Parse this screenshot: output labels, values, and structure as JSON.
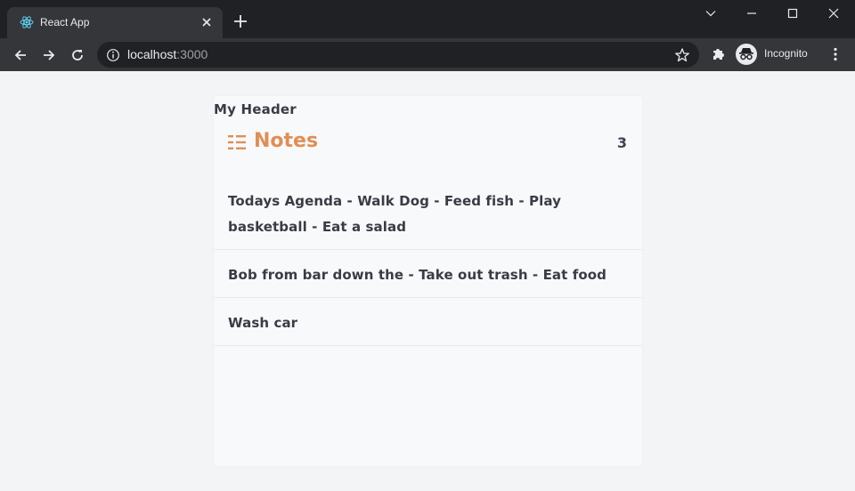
{
  "browser": {
    "tab_title": "React App",
    "url_host": "localhost",
    "url_port": ":3000",
    "incognito_label": "Incognito"
  },
  "page": {
    "header": "My Header",
    "notes_title": "Notes",
    "notes_count": "3",
    "notes": [
      {
        "text": "Todays Agenda - Walk Dog - Feed fish - Play basketball - Eat a salad"
      },
      {
        "text": "Bob from bar down the - Take out trash - Eat food"
      },
      {
        "text": "Wash car"
      }
    ]
  },
  "colors": {
    "accent": "#e08e55",
    "text": "#3b3b46",
    "card_bg": "#f8f9fa",
    "page_bg": "#f3f4f5",
    "chrome_dark": "#202124",
    "chrome_tab": "#35363a"
  },
  "icons": {
    "favicon": "react-logo-icon",
    "notes": "list-icon"
  }
}
